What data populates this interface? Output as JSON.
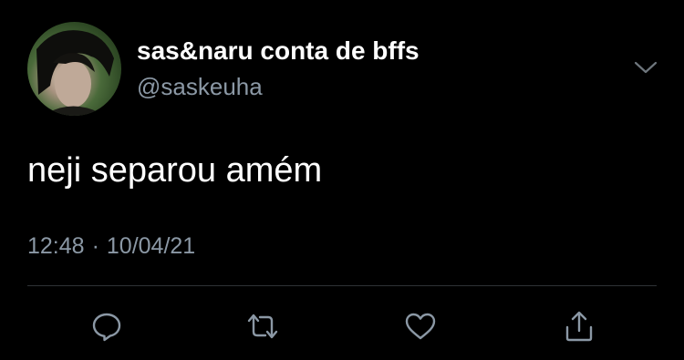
{
  "tweet": {
    "author": {
      "display_name": "sas&naru conta de bffs",
      "handle": "@saskeuha",
      "avatar_icon": "profile-photo"
    },
    "text": "neji separou amém",
    "time": "12:48",
    "separator": "·",
    "date": "10/04/21"
  },
  "actions": [
    {
      "icon": "reply-icon"
    },
    {
      "icon": "retweet-icon"
    },
    {
      "icon": "like-icon"
    },
    {
      "icon": "share-icon"
    }
  ],
  "colors": {
    "background": "#000000",
    "primary_text": "#ffffff",
    "secondary_text": "#8b98a5",
    "divider": "#2f3336"
  }
}
